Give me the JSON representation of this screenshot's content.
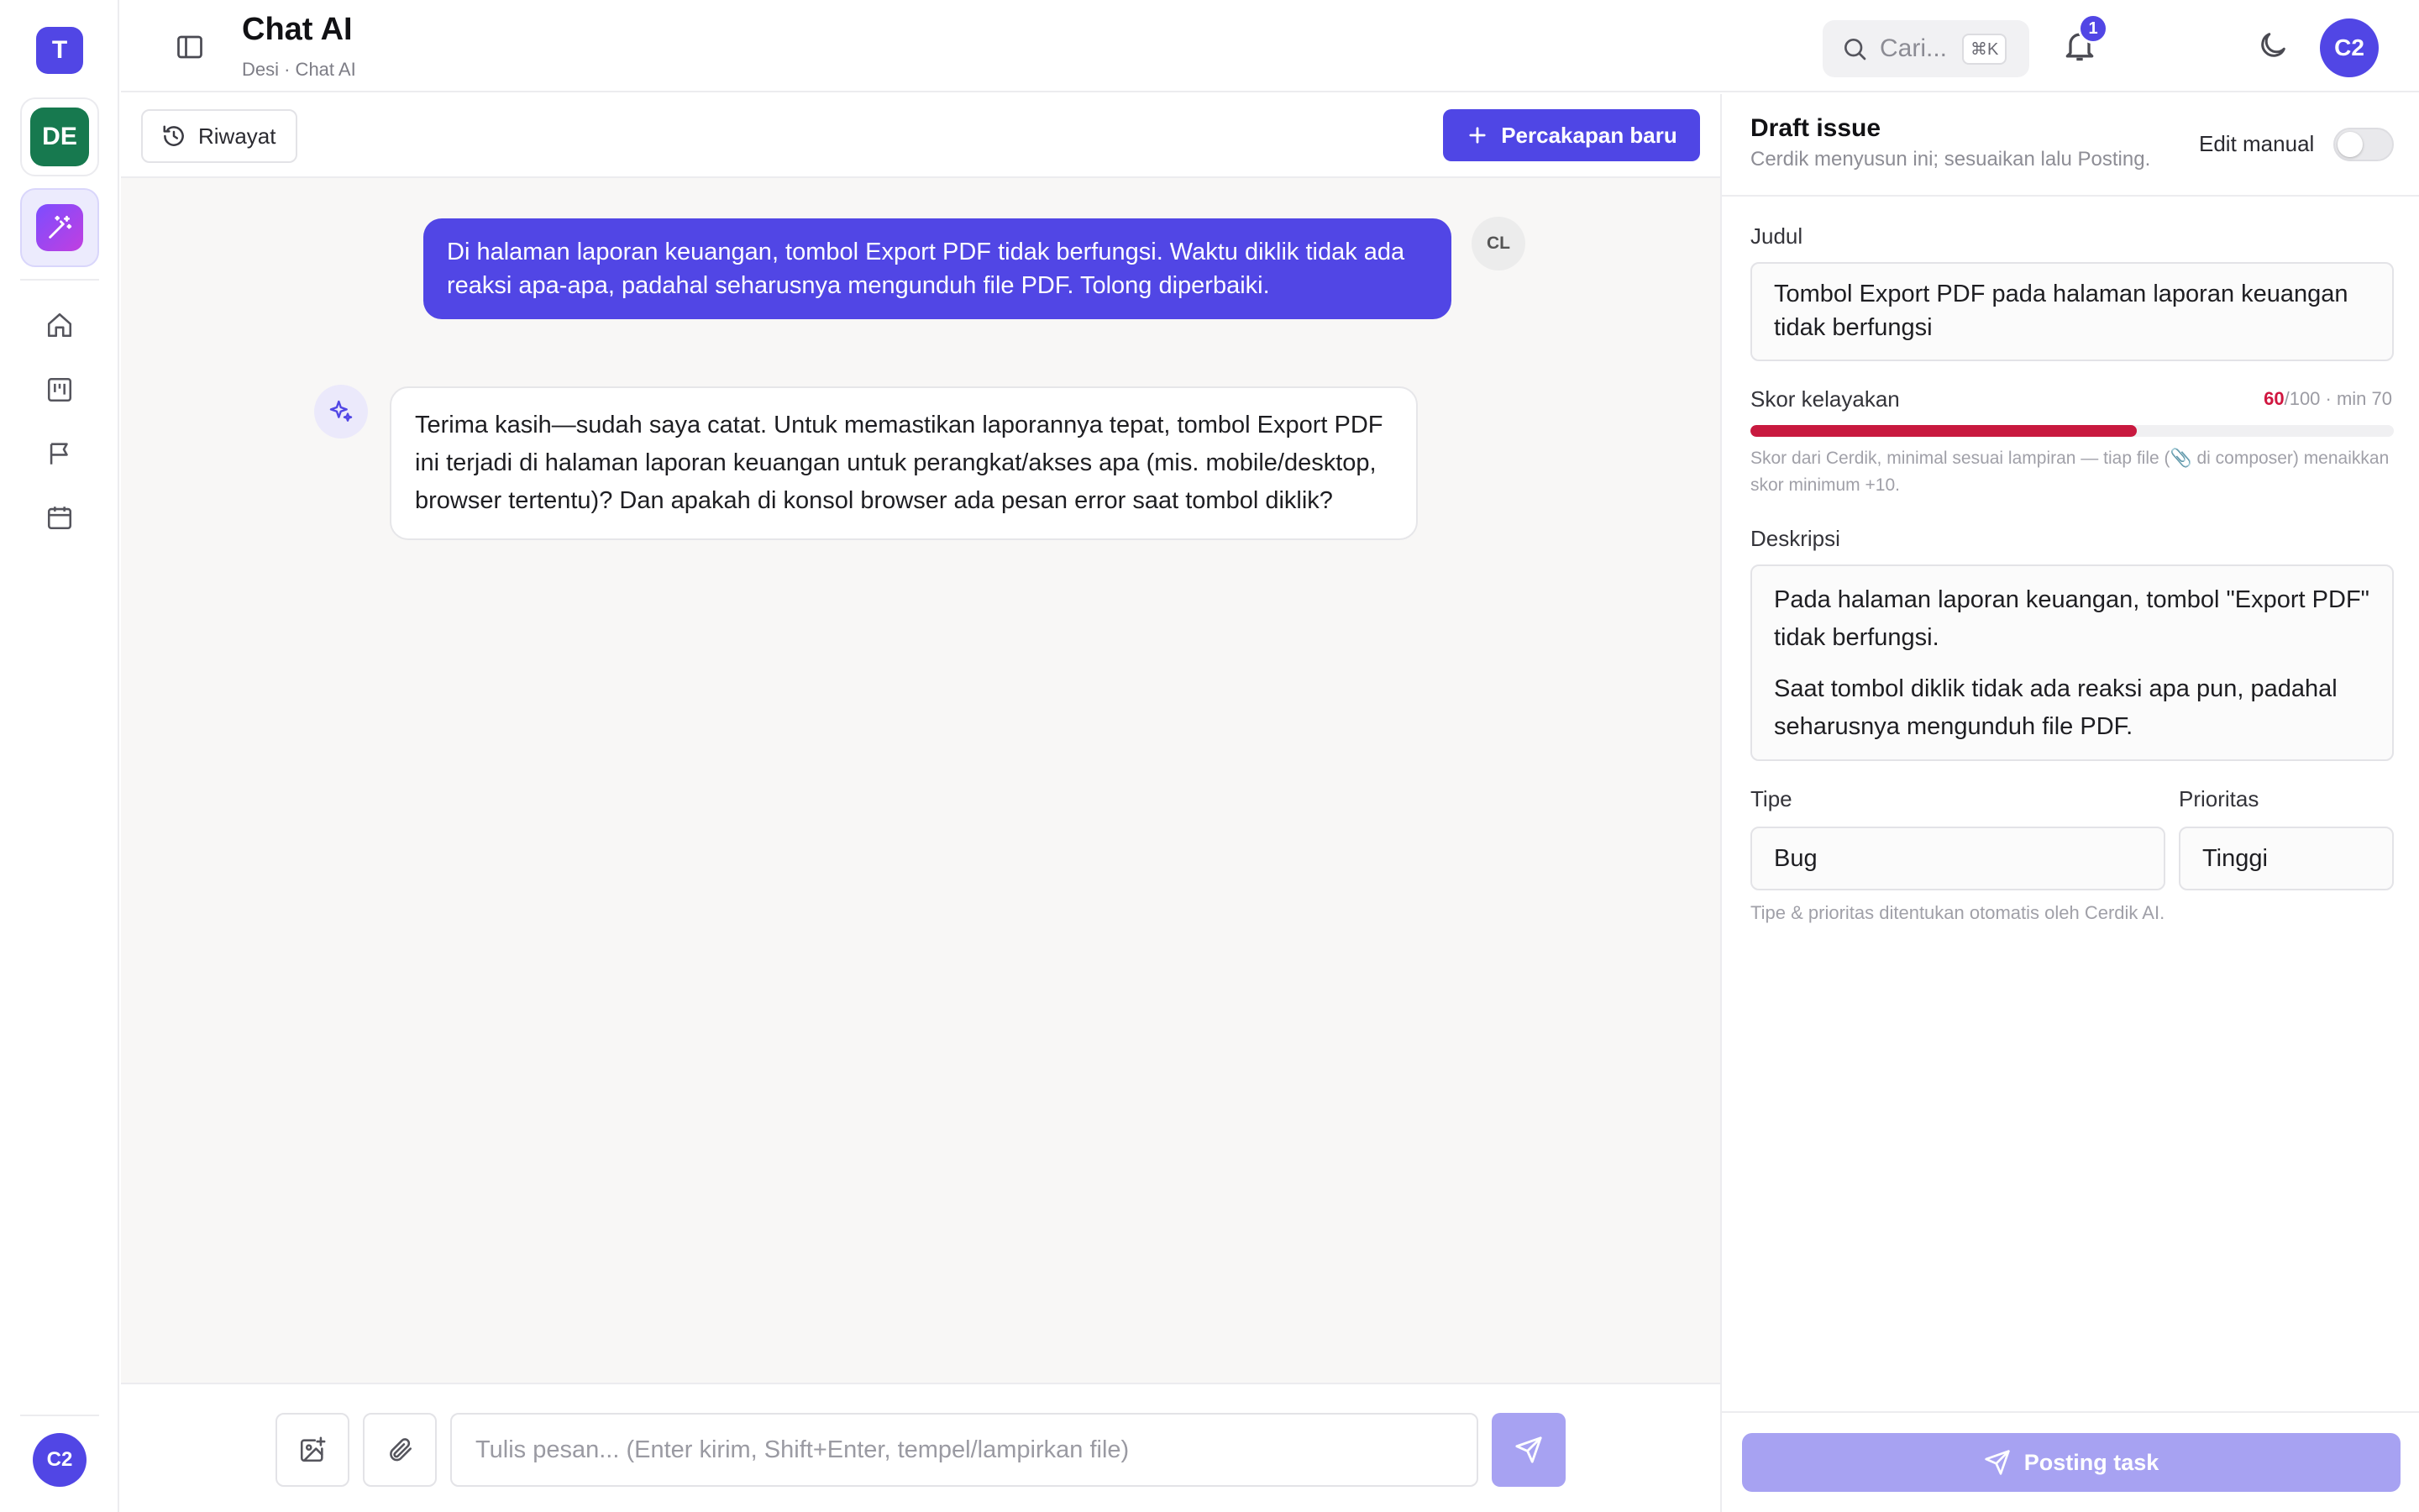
{
  "rail": {
    "workspace_initial": "T",
    "project_initials": "DE",
    "user_initials": "C2",
    "icons": [
      "home-icon",
      "kanban-icon",
      "flag-icon",
      "calendar-icon"
    ]
  },
  "header": {
    "title": "Chat AI",
    "breadcrumb": "Desi · Chat AI",
    "search_placeholder": "Cari...",
    "search_shortcut": "⌘K",
    "notification_count": "1",
    "user_initials": "C2"
  },
  "chat": {
    "history_label": "Riwayat",
    "new_chat_label": "Percakapan baru",
    "messages": [
      {
        "role": "user",
        "avatar": "CL",
        "text": "Di halaman laporan keuangan, tombol Export PDF tidak berfungsi. Waktu diklik tidak ada reaksi apa-apa, padahal seharusnya mengunduh file PDF. Tolong diperbaiki."
      },
      {
        "role": "assistant",
        "text": "Terima kasih—sudah saya catat. Untuk memastikan laporannya tepat, tombol Export PDF ini terjadi di halaman laporan keuangan untuk perangkat/akses apa (mis. mobile/desktop, browser tertentu)? Dan apakah di konsol browser ada pesan error saat tombol diklik?"
      }
    ],
    "composer_placeholder": "Tulis pesan... (Enter kirim, Shift+Enter, tempel/lampirkan file)"
  },
  "draft": {
    "title": "Draft issue",
    "subtitle": "Cerdik menyusun ini; sesuaikan lalu Posting.",
    "edit_manual_label": "Edit manual",
    "edit_manual_on": false,
    "judul_label": "Judul",
    "judul_value": "Tombol Export PDF pada halaman laporan keuangan tidak berfungsi",
    "score_label": "Skor kelayakan",
    "score": "60",
    "score_rest": "/100 · min 70",
    "score_fraction": 0.6,
    "score_note": "Skor dari Cerdik, minimal sesuai lampiran — tiap file (📎 di composer) menaikkan skor minimum +10.",
    "deskripsi_label": "Deskripsi",
    "deskripsi_p1": "Pada halaman laporan keuangan, tombol \"Export PDF\" tidak berfungsi.",
    "deskripsi_p2": "Saat tombol diklik tidak ada reaksi apa pun, padahal seharusnya mengunduh file PDF.",
    "tipe_label": "Tipe",
    "tipe_value": "Bug",
    "prioritas_label": "Prioritas",
    "prioritas_value": "Tinggi",
    "auto_note": "Tipe & prioritas ditentukan otomatis oleh Cerdik AI.",
    "post_label": "Posting task"
  },
  "colors": {
    "accent": "#5146e5",
    "accent_disabled": "#a7a2f2",
    "score_bar": "#c8193f",
    "project_badge": "#17794f"
  }
}
